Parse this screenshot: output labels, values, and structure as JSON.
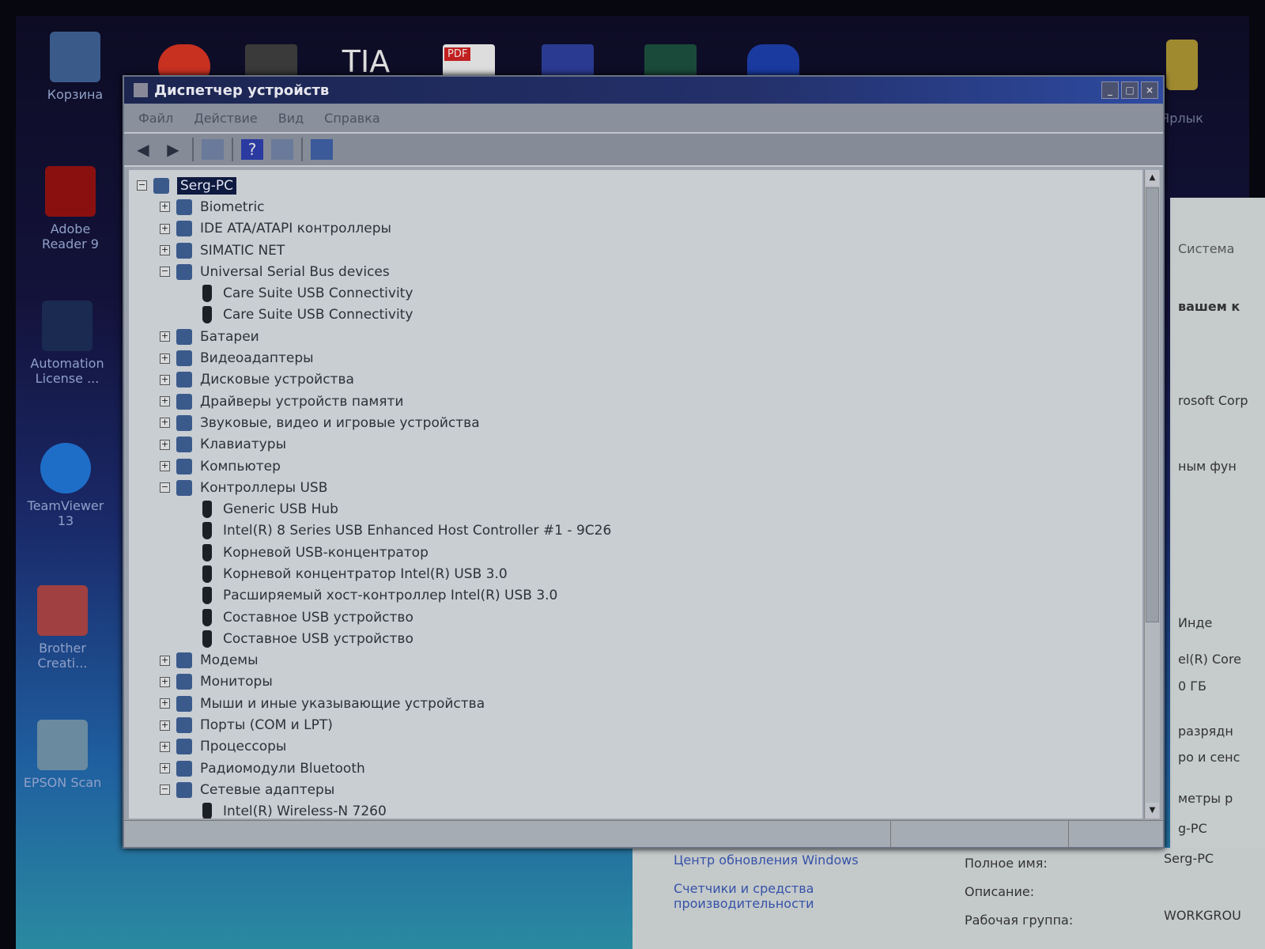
{
  "desktop": {
    "icons": [
      {
        "label": "Корзина"
      },
      {
        "label": "Adobe Reader 9"
      },
      {
        "label": "Automation License ..."
      },
      {
        "label": "TeamViewer 13"
      },
      {
        "label": "Brother Creati..."
      },
      {
        "label": "EPSON Scan"
      },
      {
        "label": "Ярлык"
      }
    ],
    "top_icons": [
      "Chrome",
      "app",
      "TIA V13",
      "PDF",
      "save",
      "monitor",
      "app"
    ]
  },
  "window": {
    "title": "Диспетчер устройств",
    "menu": [
      "Файл",
      "Действие",
      "Вид",
      "Справка"
    ],
    "toolbar": [
      "back-icon",
      "forward-icon",
      "properties-icon",
      "help-icon",
      "view-icon",
      "scan-icon"
    ]
  },
  "tree": [
    {
      "label": "Serg-PC",
      "level": 0,
      "state": "expanded",
      "selected": true
    },
    {
      "label": "Biometric",
      "level": 1,
      "state": "collapsed"
    },
    {
      "label": "IDE ATA/ATAPI контроллеры",
      "level": 1,
      "state": "collapsed"
    },
    {
      "label": "SIMATIC NET",
      "level": 1,
      "state": "collapsed"
    },
    {
      "label": "Universal Serial Bus devices",
      "level": 1,
      "state": "expanded"
    },
    {
      "label": "Care Suite USB Connectivity",
      "level": 2
    },
    {
      "label": "Care Suite USB Connectivity",
      "level": 2
    },
    {
      "label": "Батареи",
      "level": 1,
      "state": "collapsed"
    },
    {
      "label": "Видеоадаптеры",
      "level": 1,
      "state": "collapsed"
    },
    {
      "label": "Дисковые устройства",
      "level": 1,
      "state": "collapsed"
    },
    {
      "label": "Драйверы устройств памяти",
      "level": 1,
      "state": "collapsed"
    },
    {
      "label": "Звуковые, видео и игровые устройства",
      "level": 1,
      "state": "collapsed"
    },
    {
      "label": "Клавиатуры",
      "level": 1,
      "state": "collapsed"
    },
    {
      "label": "Компьютер",
      "level": 1,
      "state": "collapsed"
    },
    {
      "label": "Контроллеры USB",
      "level": 1,
      "state": "expanded"
    },
    {
      "label": "Generic USB Hub",
      "level": 2
    },
    {
      "label": "Intel(R) 8 Series USB Enhanced Host Controller #1 - 9C26",
      "level": 2
    },
    {
      "label": "Корневой USB-концентратор",
      "level": 2
    },
    {
      "label": "Корневой концентратор Intel(R) USB 3.0",
      "level": 2
    },
    {
      "label": "Расширяемый хост-контроллер Intel(R) USB 3.0",
      "level": 2
    },
    {
      "label": "Составное USB устройство",
      "level": 2
    },
    {
      "label": "Составное USB устройство",
      "level": 2
    },
    {
      "label": "Модемы",
      "level": 1,
      "state": "collapsed"
    },
    {
      "label": "Мониторы",
      "level": 1,
      "state": "collapsed"
    },
    {
      "label": "Мыши и иные указывающие устройства",
      "level": 1,
      "state": "collapsed"
    },
    {
      "label": "Порты (COM и LPT)",
      "level": 1,
      "state": "collapsed"
    },
    {
      "label": "Процессоры",
      "level": 1,
      "state": "collapsed"
    },
    {
      "label": "Радиомодули Bluetooth",
      "level": 1,
      "state": "collapsed"
    },
    {
      "label": "Сетевые адаптеры",
      "level": 1,
      "state": "expanded"
    },
    {
      "label": "Intel(R) Wireless-N 7260",
      "level": 2
    }
  ],
  "system_panel": {
    "fragments": [
      "Система",
      "вашем к",
      "rosoft Corp",
      "ным фун",
      "Инде",
      "el(R) Core",
      "0 ГБ",
      "разрядн",
      "ро и сенс",
      "метры р",
      "g-PC"
    ],
    "links": [
      "Центр обновления Windows",
      "Счетчики и средства производительности"
    ],
    "fields": [
      {
        "label": "Полное имя:",
        "value": "Serg-PC"
      },
      {
        "label": "Описание:",
        "value": ""
      },
      {
        "label": "Рабочая группа:",
        "value": "WORKGROU"
      }
    ]
  }
}
